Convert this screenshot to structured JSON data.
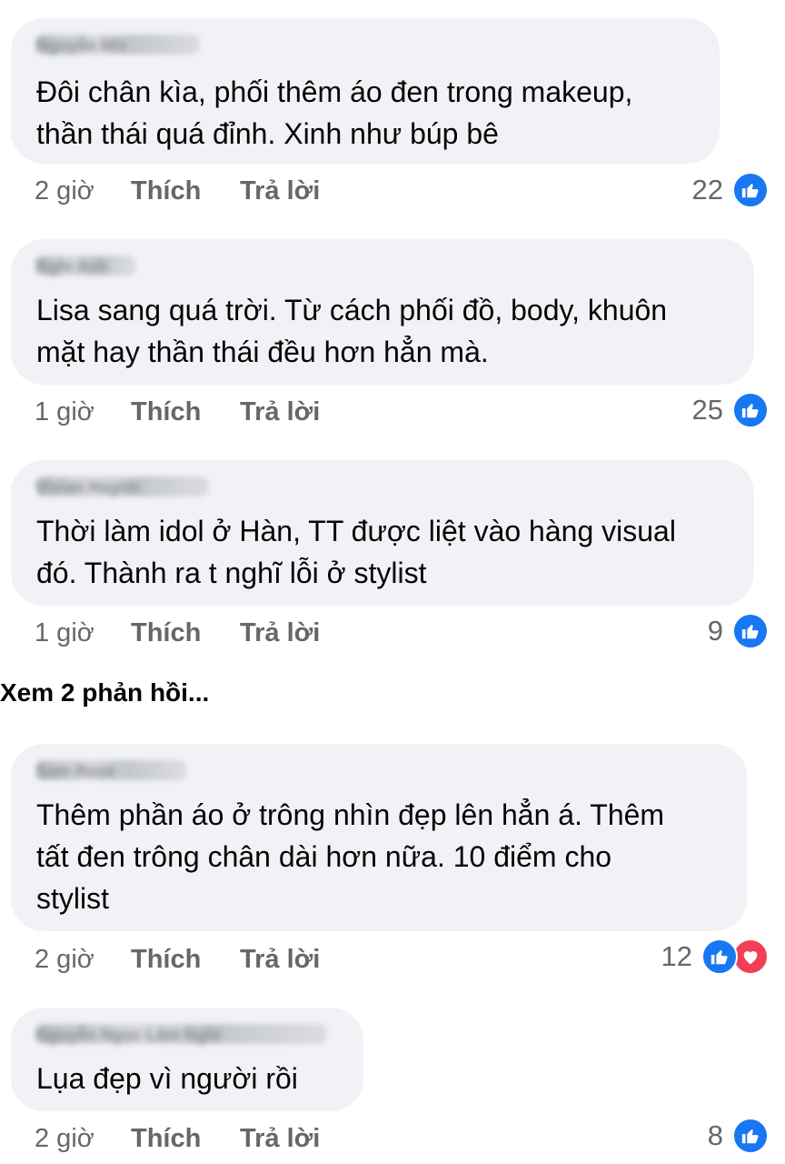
{
  "comments": [
    {
      "author": "Nguyễn Nhi",
      "text": "Đôi chân kìa, phối thêm áo đen trong makeup,\nthần thái quá đỉnh. Xinh như búp bê",
      "time": "2 giờ",
      "like_label": "Thích",
      "reply_label": "Trả lời",
      "reaction_count": "22",
      "reactions": [
        "like-icon"
      ]
    },
    {
      "author": "Nghi Anh",
      "text": "Lisa sang quá trời. Từ cách phối đồ, body, khuôn\nmặt hay thần thái đều hơn hẳn mà.",
      "time": "1 giờ",
      "like_label": "Thích",
      "reply_label": "Trả lời",
      "reaction_count": "25",
      "reactions": [
        "like-icon"
      ]
    },
    {
      "author": "Vivian Huynh",
      "text": "Thời làm idol ở Hàn, TT được liệt vào hàng visual\nđó. Thành ra t nghĩ lỗi ở stylist",
      "time": "1 giờ",
      "like_label": "Thích",
      "reply_label": "Trả lời",
      "reaction_count": "9",
      "reactions": [
        "like-icon"
      ]
    },
    {
      "author": "Sam Rosé",
      "text": "Thêm phần áo ở trông nhìn đẹp lên hẳn á. Thêm\ntất đen trông chân dài hơn nữa. 10 điểm cho\nstylist",
      "time": "2 giờ",
      "like_label": "Thích",
      "reply_label": "Trả lời",
      "reaction_count": "12",
      "reactions": [
        "like-icon",
        "love-icon"
      ]
    },
    {
      "author": "Nguyễn Ngọc Lâm Nghi",
      "text": "Lụa đẹp vì người rồi",
      "time": "2 giờ",
      "like_label": "Thích",
      "reply_label": "Trả lời",
      "reaction_count": "8",
      "reactions": [
        "like-icon"
      ]
    }
  ],
  "more_replies_label": "Xem 2 phản hồi...",
  "colors": {
    "bubble": "#f0f2f5",
    "meta_text": "#65676b",
    "like_blue": "#1877f2",
    "love_red": "#f33e58"
  }
}
